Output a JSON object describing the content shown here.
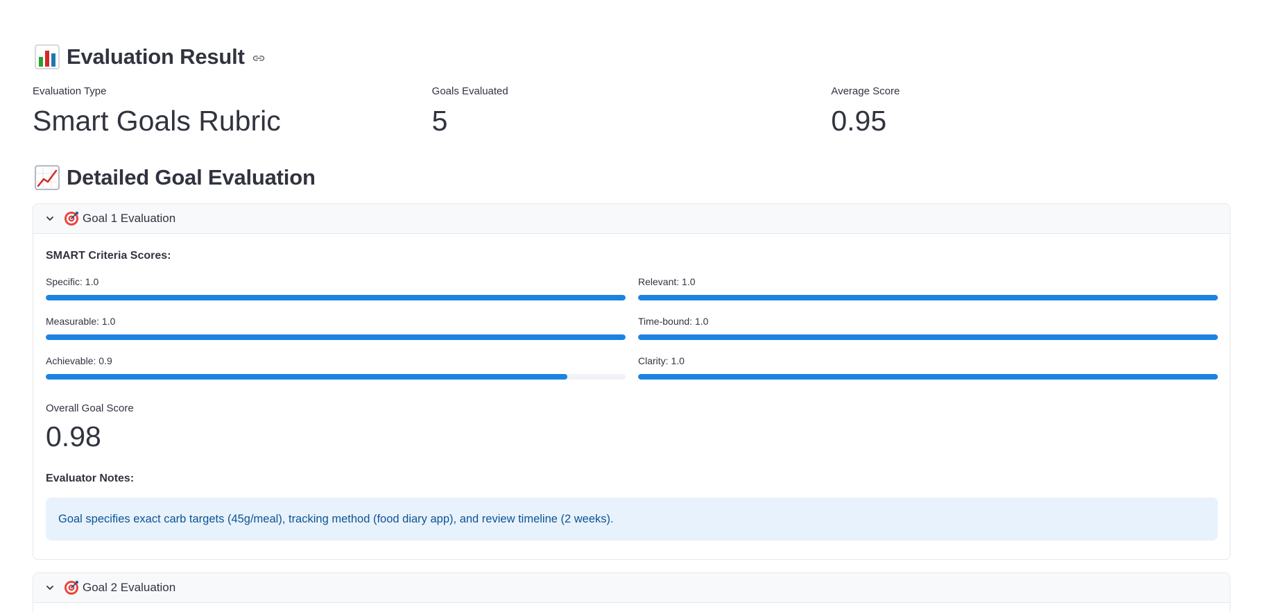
{
  "result": {
    "heading": "Evaluation Result"
  },
  "metrics": [
    {
      "label": "Evaluation Type",
      "value": "Smart Goals Rubric"
    },
    {
      "label": "Goals Evaluated",
      "value": "5"
    },
    {
      "label": "Average Score",
      "value": "0.95"
    }
  ],
  "detail": {
    "heading": "Detailed Goal Evaluation"
  },
  "goals": [
    {
      "title": "Goal 1 Evaluation",
      "expanded": true,
      "criteria_title": "SMART Criteria Scores:",
      "criteria": [
        {
          "label": "Specific: 1.0",
          "score": 1.0
        },
        {
          "label": "Relevant: 1.0",
          "score": 1.0
        },
        {
          "label": "Measurable: 1.0",
          "score": 1.0
        },
        {
          "label": "Time-bound: 1.0",
          "score": 1.0
        },
        {
          "label": "Achievable: 0.9",
          "score": 0.9
        },
        {
          "label": "Clarity: 1.0",
          "score": 1.0
        }
      ],
      "overall_label": "Overall Goal Score",
      "overall_value": "0.98",
      "notes_title": "Evaluator Notes:",
      "notes": "Goal specifies exact carb targets (45g/meal), tracking method (food diary app), and review timeline (2 weeks)."
    },
    {
      "title": "Goal 2 Evaluation",
      "expanded": false
    }
  ],
  "colors": {
    "progress": "#1c83e1",
    "track": "#f0f2f6",
    "notes_bg": "#e8f2fc",
    "notes_text": "#0b5394",
    "text": "#31333f"
  },
  "icons": {
    "result_heading": "bar-chart-icon",
    "detail_heading": "chart-increasing-icon",
    "anchor": "link-icon",
    "expander_toggle": "chevron-down-icon",
    "goal": "direct-hit-target-icon"
  }
}
